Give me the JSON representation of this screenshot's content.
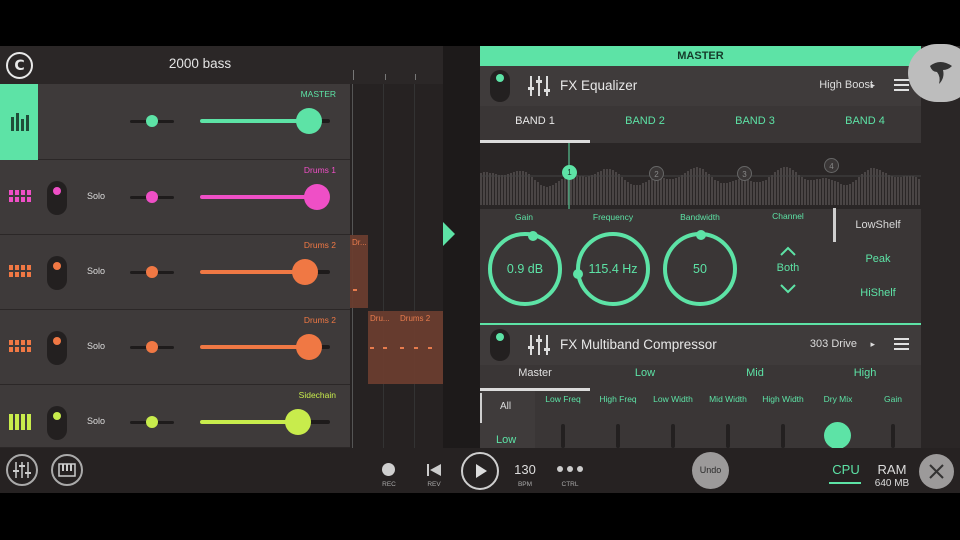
{
  "project": {
    "title": "2000 bass"
  },
  "tracks": [
    {
      "name": "MASTER",
      "color": "#5de3a6",
      "solo": "",
      "pan": 0.5,
      "volume": 0.84
    },
    {
      "name": "Drums 1",
      "color": "#ef4fc6",
      "solo": "Solo",
      "pan": 0.5,
      "volume": 0.9
    },
    {
      "name": "Drums 2",
      "color": "#f07844",
      "solo": "Solo",
      "pan": 0.5,
      "volume": 0.8
    },
    {
      "name": "Drums 2",
      "color": "#f07844",
      "solo": "Solo",
      "pan": 0.5,
      "volume": 0.84
    },
    {
      "name": "Sidechain",
      "color": "#c8ec4c",
      "solo": "Solo",
      "pan": 0.5,
      "volume": 0.75
    }
  ],
  "playlist": {
    "clips": [
      {
        "name": "Dr..."
      },
      {
        "name": "Dru..."
      },
      {
        "name": "Drums 2"
      }
    ]
  },
  "fx_panel": {
    "bar_title": "MASTER",
    "equalizer": {
      "name": "FX Equalizer",
      "preset": "High Boost",
      "bands": [
        "BAND 1",
        "BAND 2",
        "BAND 3",
        "BAND 4"
      ],
      "active_band": "BAND 1",
      "nodes": [
        "1",
        "2",
        "3",
        "4"
      ],
      "gain_label": "Gain",
      "gain_value": "0.9 dB",
      "frequency_label": "Frequency",
      "frequency_value": "115.4 Hz",
      "bandwidth_label": "Bandwidth",
      "bandwidth_value": "50",
      "channel_label": "Channel",
      "channel_value": "Both",
      "shapes": [
        "LowShelf",
        "Peak",
        "HiShelf"
      ],
      "selected_shape": "LowShelf"
    },
    "compressor": {
      "name": "FX Multiband Compressor",
      "preset": "303 Drive",
      "tabs": [
        "Master",
        "Low",
        "Mid",
        "High"
      ],
      "active_tab": "Master",
      "all_label": "All",
      "band_label": "Low",
      "params": [
        "Low Freq",
        "High Freq",
        "Low Width",
        "Mid Width",
        "High Width",
        "Dry Mix",
        "Gain"
      ]
    }
  },
  "transport": {
    "rec": "REC",
    "rev": "REV",
    "bpm_value": "130",
    "bpm_label": "BPM",
    "ctrl": "CTRL",
    "undo": "Undo",
    "cpu": "CPU",
    "ram_label": "RAM",
    "ram_value": "640 MB"
  },
  "colors": {
    "accent": "#5de3a6",
    "pink": "#ef4fc6",
    "orange": "#f07844",
    "lime": "#c8ec4c"
  }
}
